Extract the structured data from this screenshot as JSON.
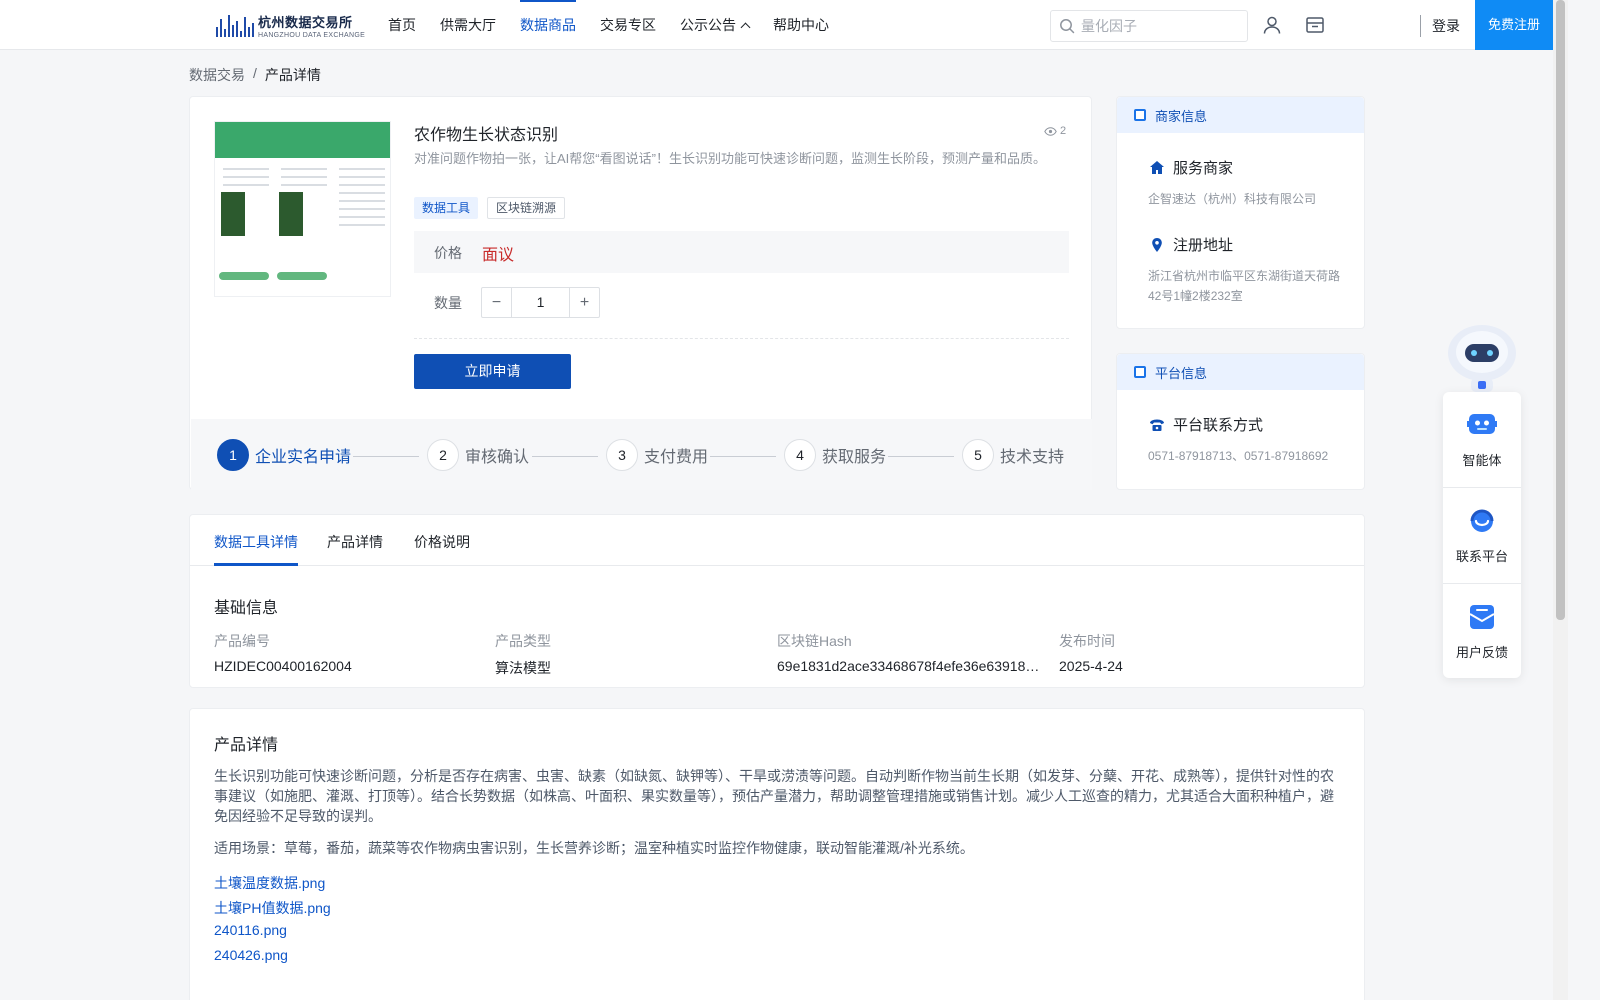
{
  "header": {
    "logo_cn": "杭州数据交易所",
    "logo_en": "HANGZHOU DATA EXCHANGE",
    "nav": [
      {
        "label": "首页"
      },
      {
        "label": "供需大厅"
      },
      {
        "label": "数据商品"
      },
      {
        "label": "交易专区"
      },
      {
        "label": "公示公告"
      },
      {
        "label": "帮助中心"
      }
    ],
    "active_nav": "数据商品",
    "search_placeholder": "量化因子",
    "login_label": "登录",
    "register_label": "免费注册",
    "icons": [
      "search-icon",
      "user-icon",
      "store-icon"
    ],
    "accent": "#0f56c8"
  },
  "breadcrumb": {
    "parent": "数据交易",
    "separator": "/",
    "current": "产品详情"
  },
  "product": {
    "title": "农作物生长状态识别",
    "views": "2",
    "description": "对准问题作物拍一张，让AI帮您“看图说话”！生长识别功能可快速诊断问题，监测生长阶段，预测产量和品质。",
    "tags": [
      "数据工具",
      "区块链溯源"
    ],
    "price_label": "价格",
    "price_value": "面议",
    "price_color": "#c82b2b",
    "quantity_label": "数量",
    "quantity_value": "1",
    "apply_label": "立即申请"
  },
  "steps": [
    {
      "num": "1",
      "label": "企业实名申请"
    },
    {
      "num": "2",
      "label": "审核确认"
    },
    {
      "num": "3",
      "label": "支付费用"
    },
    {
      "num": "4",
      "label": "获取服务"
    },
    {
      "num": "5",
      "label": "技术支持"
    }
  ],
  "merchant": {
    "header": "商家信息",
    "service_title": "服务商家",
    "service_value": "企智速达（杭州）科技有限公司",
    "address_title": "注册地址",
    "address_value": "浙江省杭州市临平区东湖街道天荷路42号1幢2楼232室"
  },
  "platform": {
    "header": "平台信息",
    "contact_title": "平台联系方式",
    "contact_value": "0571-87918713、0571-87918692"
  },
  "float_widget": {
    "items": [
      {
        "label": "智能体",
        "icon": "bot-icon"
      },
      {
        "label": "联系平台",
        "icon": "headset-icon"
      },
      {
        "label": "用户反馈",
        "icon": "feedback-icon"
      }
    ]
  },
  "tabs": [
    {
      "label": "数据工具详情"
    },
    {
      "label": "产品详情"
    },
    {
      "label": "价格说明"
    }
  ],
  "basic_info": {
    "title": "基础信息",
    "fields": [
      {
        "key": "产品编号",
        "value": "HZIDEC00400162004"
      },
      {
        "key": "产品类型",
        "value": "算法模型"
      },
      {
        "key": "区块链Hash",
        "value": "69e1831d2ace33468678f4efe36e63918d…"
      },
      {
        "key": "发布时间",
        "value": "2025-4-24"
      }
    ]
  },
  "detail": {
    "title": "产品详情",
    "paragraph1": "生长识别功能可快速诊断问题，分析是否存在病害、虫害、缺素（如缺氮、缺钾等）、干旱或涝渍等问题。自动判断作物当前生长期（如发芽、分蘖、开花、成熟等），提供针对性的农事建议（如施肥、灌溉、打顶等）。结合长势数据（如株高、叶面积、果实数量等），预估产量潜力，帮助调整管理措施或销售计划。减少人工巡查的精力，尤其适合大面积种植户，避免因经验不足导致的误判。",
    "paragraph2": "适用场景：草莓，番茄，蔬菜等农作物病虫害识别，生长营养诊断；温室种植实时监控作物健康，联动智能灌溉/补光系统。",
    "files": [
      "土壤温度数据.png",
      "土壤PH值数据.png",
      "240116.png",
      "240426.png"
    ]
  }
}
